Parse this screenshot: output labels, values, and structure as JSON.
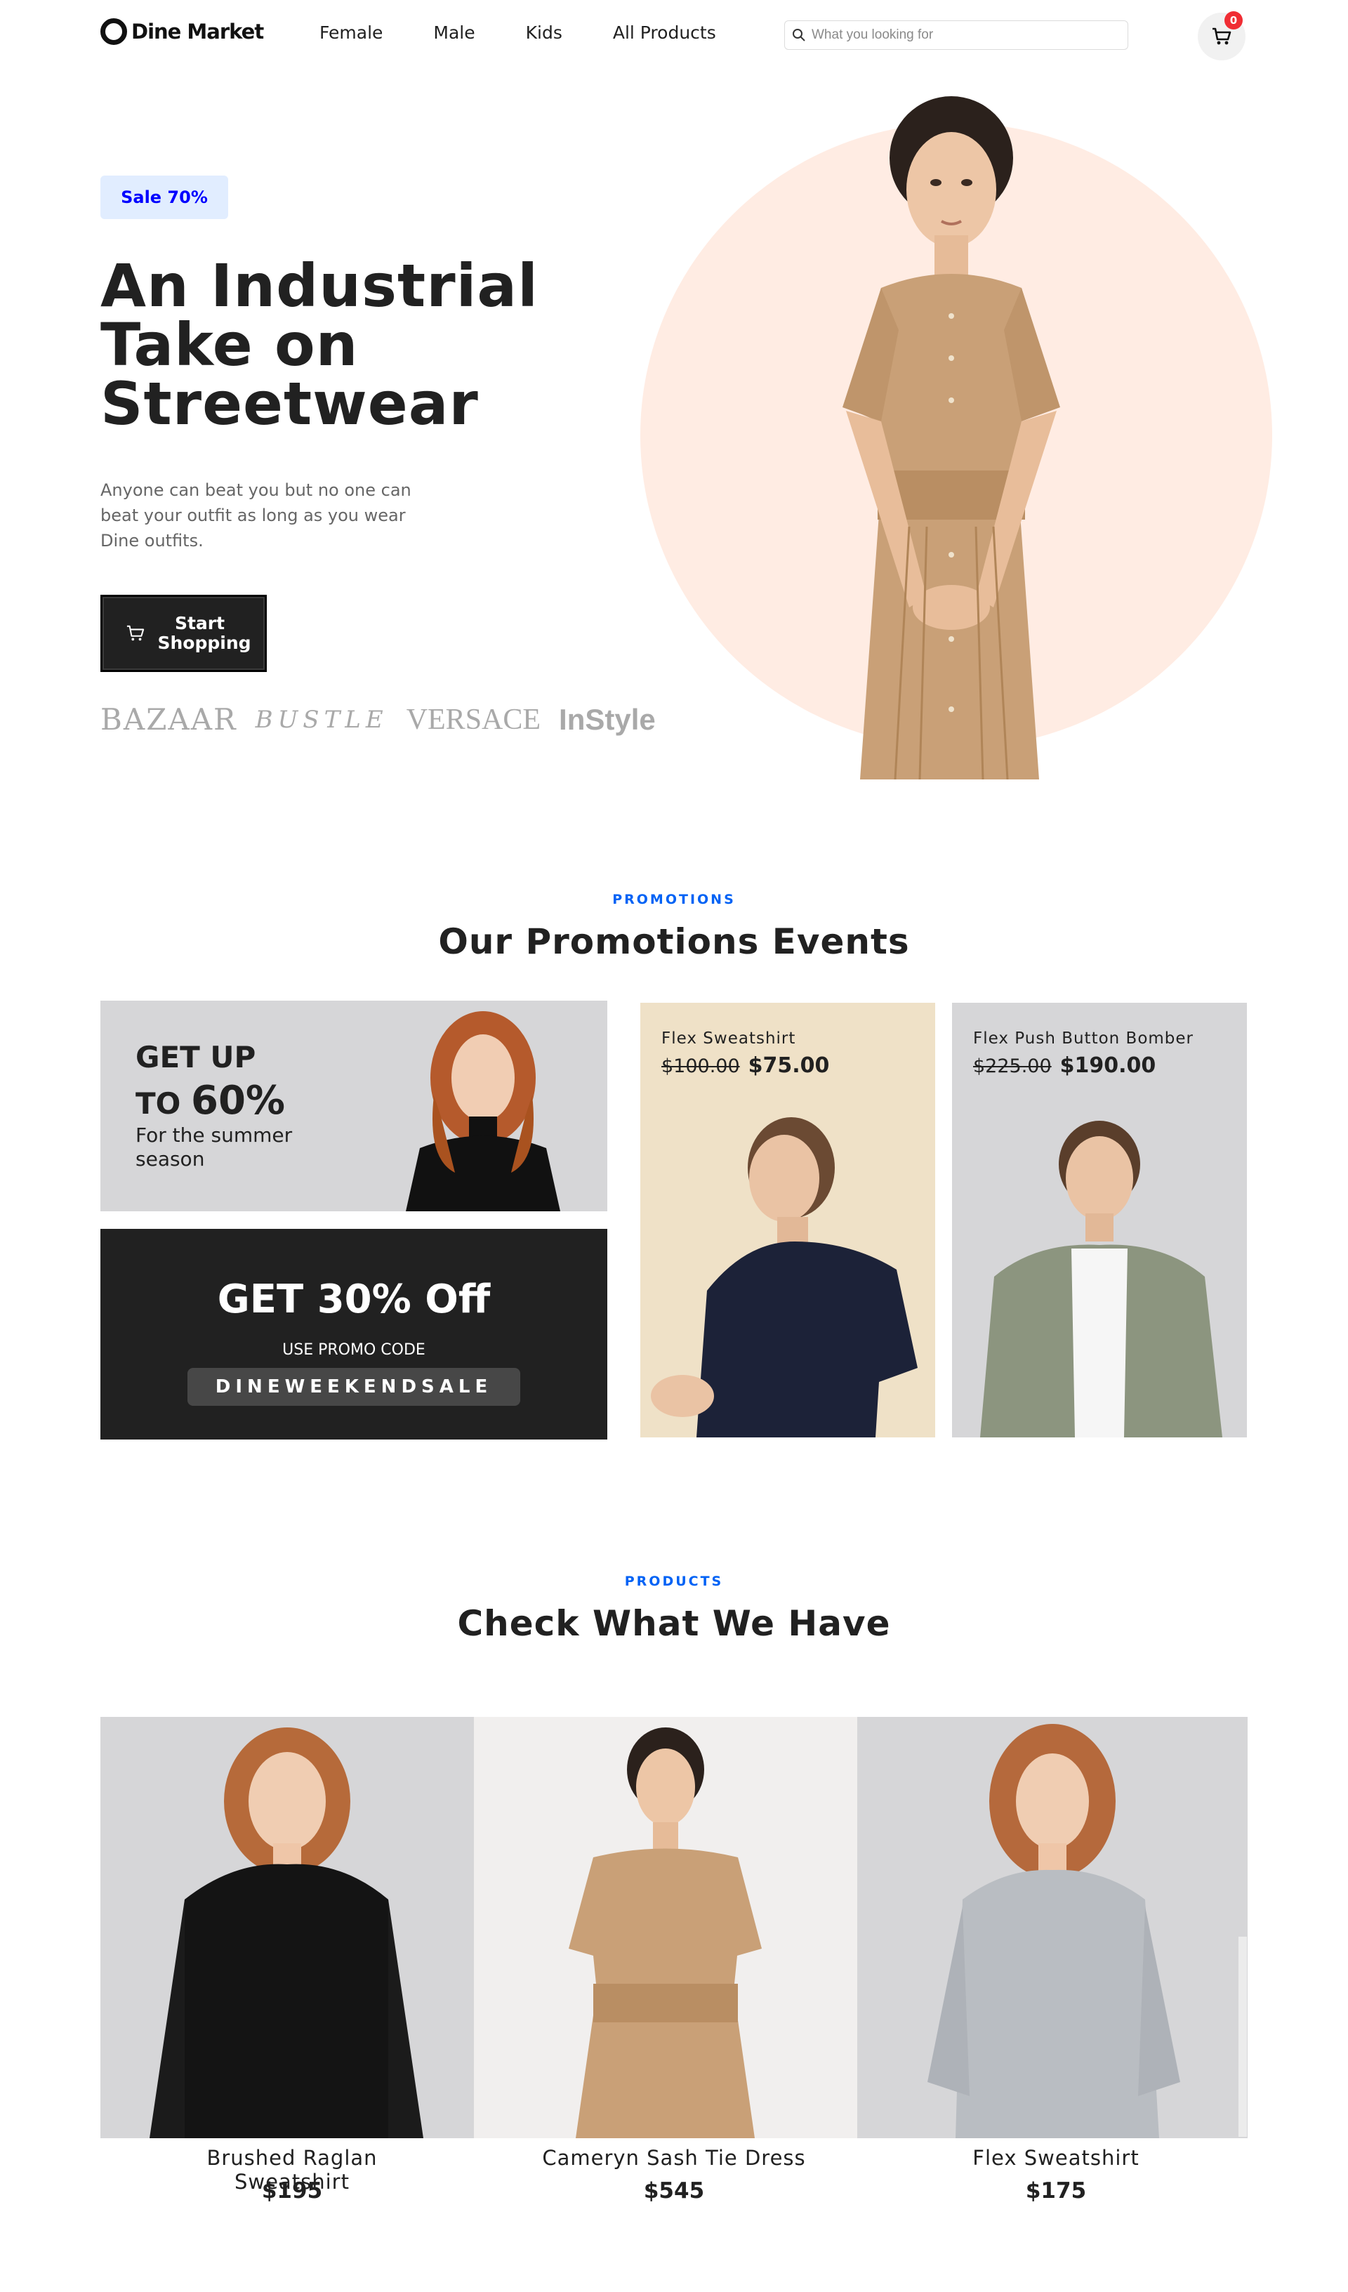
{
  "nav": {
    "brand": "Dine Market",
    "links": [
      "Female",
      "Male",
      "Kids",
      "All Products"
    ],
    "search_placeholder": "What you looking for",
    "cart_count": "0"
  },
  "hero": {
    "badge": "Sale 70%",
    "title": "An Industrial Take on Streetwear",
    "description": "Anyone can beat you but no one can beat your outfit as long as you wear Dine outfits.",
    "cta_label": "Start Shopping",
    "brands": [
      "BAZAAR",
      "BUSTLE",
      "VERSACE",
      "InStyle"
    ]
  },
  "promotions": {
    "eyebrow": "PROMOTIONS",
    "title": "Our Promotions Events",
    "sale_card": {
      "line1": "GET UP",
      "line2_prefix": "TO",
      "line2_value": "60%",
      "line3": "For the summer season"
    },
    "code_card": {
      "headline": "GET 30% Off",
      "subtext": "USE PROMO CODE",
      "code": "DINEWEEKENDSALE"
    },
    "items": [
      {
        "name": "Flex Sweatshirt",
        "old_price": "$100.00",
        "new_price": "$75.00"
      },
      {
        "name": "Flex Push Button Bomber",
        "old_price": "$225.00",
        "new_price": "$190.00"
      }
    ]
  },
  "products": {
    "eyebrow": "PRODUCTS",
    "title": "Check What We Have",
    "items": [
      {
        "name": "Brushed Raglan Sweatshirt",
        "price": "$195"
      },
      {
        "name": "Cameryn Sash Tie Dress",
        "price": "$545"
      },
      {
        "name": "Flex Sweatshirt",
        "price": "$175"
      }
    ]
  },
  "colors": {
    "accent_blue": "#0062f5",
    "badge_bg": "#e1edff",
    "dark": "#212121",
    "hero_circle": "#ffece3",
    "cart_badge": "#f02d34"
  }
}
